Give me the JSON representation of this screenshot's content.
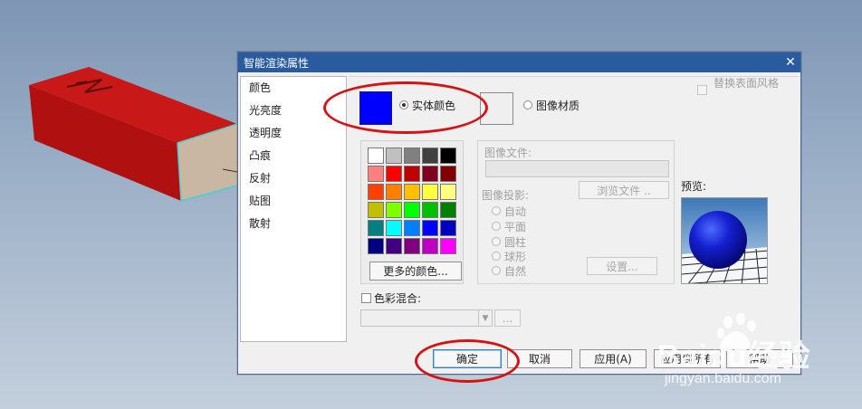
{
  "dialog": {
    "title": "智能渲染属性",
    "close_icon": "close-icon"
  },
  "sidebar": {
    "items": [
      {
        "label": "颜色"
      },
      {
        "label": "光亮度"
      },
      {
        "label": "透明度"
      },
      {
        "label": "凸痕"
      },
      {
        "label": "反射"
      },
      {
        "label": "贴图"
      },
      {
        "label": "散射"
      }
    ]
  },
  "color_panel": {
    "solid_color_label": "实体颜色",
    "image_material_label": "图像材质",
    "replace_surface_style_label": "替换表面风格",
    "current_color": "#0000ff",
    "more_colors_button": "更多的颜色...",
    "palette": [
      "#ffffff",
      "#c0c0c0",
      "#808080",
      "#404040",
      "#000000",
      "#ff8080",
      "#ff0000",
      "#c00000",
      "#800020",
      "#800000",
      "#ff4000",
      "#ff8000",
      "#ffc000",
      "#ffff40",
      "#ffff80",
      "#c0c000",
      "#80ff00",
      "#00ff00",
      "#00c000",
      "#008000",
      "#008080",
      "#00ffff",
      "#0080ff",
      "#0000ff",
      "#0000c0",
      "#000080",
      "#400080",
      "#800080",
      "#c000c0",
      "#ff00ff"
    ]
  },
  "image_file": {
    "label": "图像文件:",
    "browse_button": "浏览文件 ..",
    "projection_label": "图像投影:",
    "projections": [
      {
        "label": "自动"
      },
      {
        "label": "平面"
      },
      {
        "label": "圆柱"
      },
      {
        "label": "球形"
      },
      {
        "label": "自然"
      }
    ],
    "settings_button": "设置..."
  },
  "preview": {
    "label": "预览:"
  },
  "blend": {
    "label": "色彩混合:",
    "more_button": "..."
  },
  "footer": {
    "ok": "确定",
    "cancel": "取消",
    "apply": "应用(A)",
    "apply_to_all": "应用到所有",
    "help": "帮助"
  },
  "watermark": {
    "brand": "Baidu经验",
    "url": "jingyan.baidu.com"
  },
  "annotation_color": "#d41414"
}
